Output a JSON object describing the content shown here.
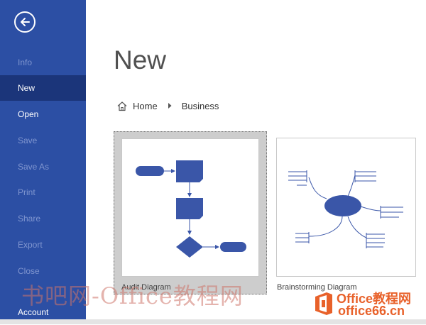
{
  "sidebar": {
    "items": [
      {
        "label": "Info",
        "state": "disabled"
      },
      {
        "label": "New",
        "state": "selected"
      },
      {
        "label": "Open",
        "state": "enabled"
      },
      {
        "label": "Save",
        "state": "disabled"
      },
      {
        "label": "Save As",
        "state": "disabled"
      },
      {
        "label": "Print",
        "state": "disabled"
      },
      {
        "label": "Share",
        "state": "disabled"
      },
      {
        "label": "Export",
        "state": "disabled"
      },
      {
        "label": "Close",
        "state": "disabled"
      },
      {
        "label": "Account",
        "state": "enabled"
      }
    ],
    "back_icon": "back-arrow-icon"
  },
  "main": {
    "title": "New",
    "breadcrumb": {
      "home": "Home",
      "current": "Business"
    },
    "templates": [
      {
        "label": "Audit Diagram",
        "selected": true
      },
      {
        "label": "Brainstorming Diagram",
        "selected": false
      }
    ]
  },
  "watermark": {
    "text": "书吧网-Office教程网",
    "brand": "Office教程网",
    "domain": "office66.cn"
  },
  "colors": {
    "sidebar_bg": "#2c4fa4",
    "sidebar_selected": "#1b357a",
    "diagram_blue": "#3a56a8",
    "watermark_orange": "#e8612a"
  }
}
